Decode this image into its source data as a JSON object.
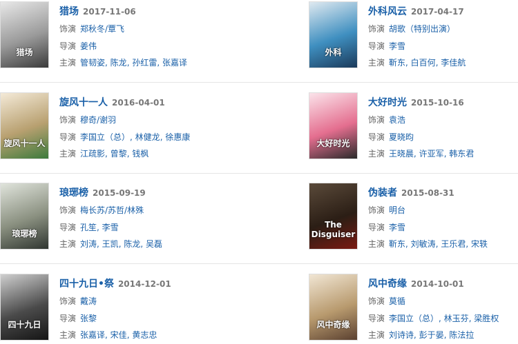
{
  "labels": {
    "role": "饰演",
    "director": "导演",
    "cast": "主演"
  },
  "items": [
    {
      "title": "猎场",
      "date": "2017-11-06",
      "role": "郑秋冬/覃飞",
      "directors": [
        "姜伟"
      ],
      "cast": [
        "管韧姿",
        "陈龙",
        "孙红雷",
        "张嘉译"
      ],
      "poster": {
        "colors": [
          "#e8e8e8",
          "#9a9a9a",
          "#3a3a3a"
        ],
        "text": "猎场"
      }
    },
    {
      "title": "外科风云",
      "date": "2017-04-17",
      "role": "胡歌（特别出演）",
      "directors": [
        "李雪"
      ],
      "cast": [
        "靳东",
        "白百何",
        "李佳航"
      ],
      "poster": {
        "colors": [
          "#dfe9f0",
          "#3f8fc0",
          "#1b3a5a"
        ],
        "text": "外科"
      }
    },
    {
      "title": "旋风十一人",
      "date": "2016-04-01",
      "role": "穆奇/谢羽",
      "directors": [
        "李国立（总）",
        "林健龙",
        "徐惠康"
      ],
      "cast": [
        "江疏影",
        "曾黎",
        "钱枫"
      ],
      "poster": {
        "colors": [
          "#f4ead8",
          "#b8a070",
          "#3c7a3c"
        ],
        "text": "旋风十一人"
      }
    },
    {
      "title": "大好时光",
      "date": "2015-10-16",
      "role": "袁浩",
      "directors": [
        "夏晓昀"
      ],
      "cast": [
        "王晓晨",
        "许亚军",
        "韩东君"
      ],
      "poster": {
        "colors": [
          "#fbe3ea",
          "#e46e8f",
          "#2a2a2a"
        ],
        "text": "大好时光"
      }
    },
    {
      "title": "琅琊榜",
      "date": "2015-09-19",
      "role": "梅长苏/苏哲/林殊",
      "directors": [
        "孔笙",
        "李雪"
      ],
      "cast": [
        "刘涛",
        "王凯",
        "陈龙",
        "吴磊"
      ],
      "poster": {
        "colors": [
          "#e0e4dc",
          "#8a9080",
          "#2f3530"
        ],
        "text": "琅琊榜"
      }
    },
    {
      "title": "伪装者",
      "date": "2015-08-31",
      "role": "明台",
      "directors": [
        "李雪"
      ],
      "cast": [
        "靳东",
        "刘敏涛",
        "王乐君",
        "宋轶"
      ],
      "poster": {
        "colors": [
          "#5a4a3a",
          "#2b1e15",
          "#7a1a12"
        ],
        "text": "The Disguiser"
      }
    },
    {
      "title": "四十九日•祭",
      "date": "2014-12-01",
      "role": "戴涛",
      "directors": [
        "张黎"
      ],
      "cast": [
        "张嘉译",
        "宋佳",
        "黄志忠"
      ],
      "poster": {
        "colors": [
          "#cfcfcf",
          "#4a4a4a",
          "#151515"
        ],
        "text": "四十九日"
      }
    },
    {
      "title": "风中奇缘",
      "date": "2014-10-01",
      "role": "莫循",
      "directors": [
        "李国立（总）",
        "林玉芬",
        "梁胜权"
      ],
      "cast": [
        "刘诗诗",
        "彭于晏",
        "陈法拉"
      ],
      "poster": {
        "colors": [
          "#f1e6d4",
          "#b89a6e",
          "#5a4030"
        ],
        "text": "风中奇缘"
      }
    }
  ]
}
